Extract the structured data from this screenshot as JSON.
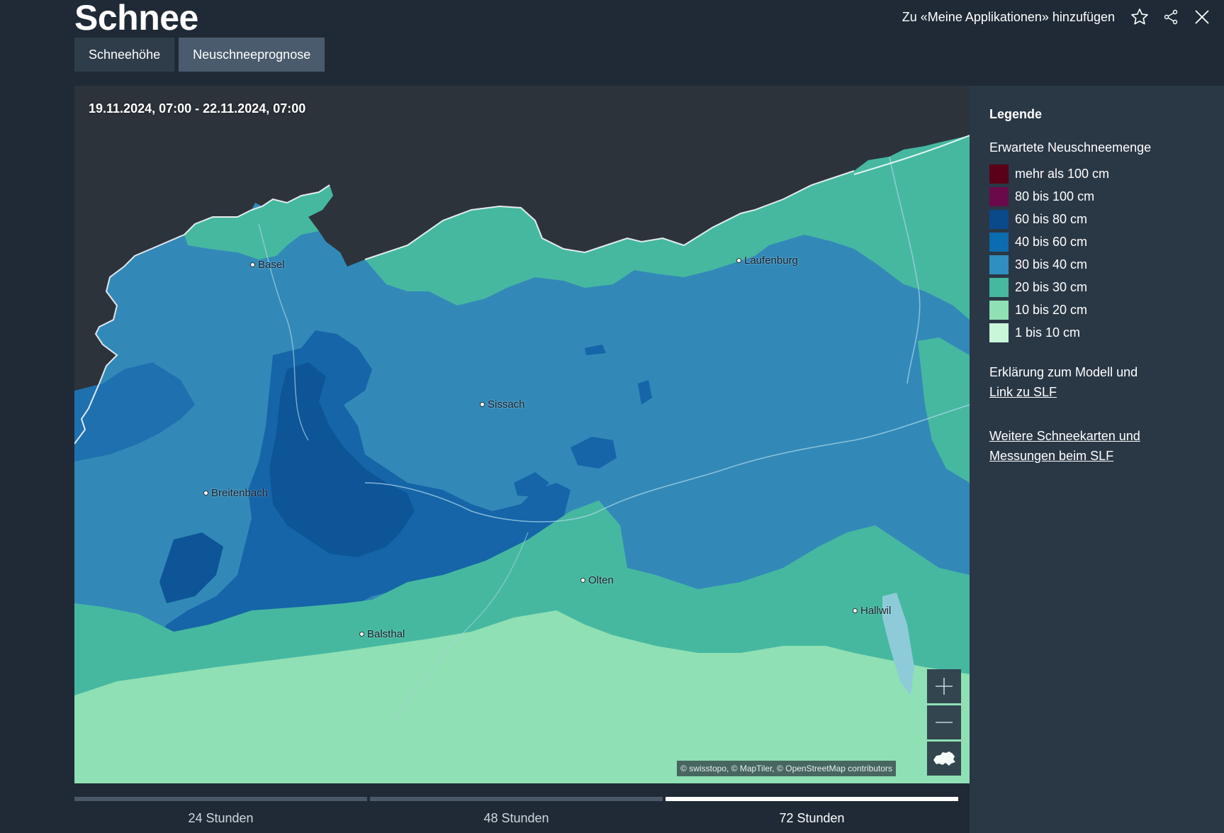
{
  "header": {
    "title": "Schnee",
    "add_apps_label": "Zu «Meine Applikationen» hinzufügen",
    "icons": [
      "star-icon",
      "share-icon",
      "close-icon"
    ]
  },
  "tabs": [
    {
      "label": "Schneehöhe",
      "active": false
    },
    {
      "label": "Neuschneeprognose",
      "active": true
    }
  ],
  "map": {
    "date_range": "19.11.2024, 07:00 - 22.11.2024, 07:00",
    "places": [
      "Basel",
      "Laufenburg",
      "Sissach",
      "Breitenbach",
      "Olten",
      "Hallwil",
      "Balsthal"
    ],
    "attribution": "© swisstopo, © MapTiler, © OpenStreetMap contributors",
    "controls": [
      "zoom-in-icon",
      "zoom-out-icon",
      "switzerland-icon"
    ]
  },
  "legend": {
    "title": "Legende",
    "subtitle": "Erwartete Neuschneemenge",
    "items": [
      {
        "label": "mehr als 100 cm",
        "color": "#5a0018"
      },
      {
        "label": "80 bis 100 cm",
        "color": "#6a0a4a"
      },
      {
        "label": "60 bis 80 cm",
        "color": "#0a4a8a"
      },
      {
        "label": "40 bis 60 cm",
        "color": "#0c6cb0"
      },
      {
        "label": "30 bis 40 cm",
        "color": "#2f8fbe"
      },
      {
        "label": "20 bis 30 cm",
        "color": "#46b8a0"
      },
      {
        "label": "10 bis 20 cm",
        "color": "#8fe0b4"
      },
      {
        "label": "1 bis 10 cm",
        "color": "#c9f5d8"
      }
    ],
    "model_text": "Erklärung zum Modell und",
    "model_link": "Link zu SLF",
    "more_link_line1": "Weitere Schneekarten und",
    "more_link_line2": "Messungen beim SLF"
  },
  "timeline": [
    {
      "label": "24 Stunden",
      "active": false
    },
    {
      "label": "48 Stunden",
      "active": false
    },
    {
      "label": "72 Stunden",
      "active": true
    }
  ]
}
